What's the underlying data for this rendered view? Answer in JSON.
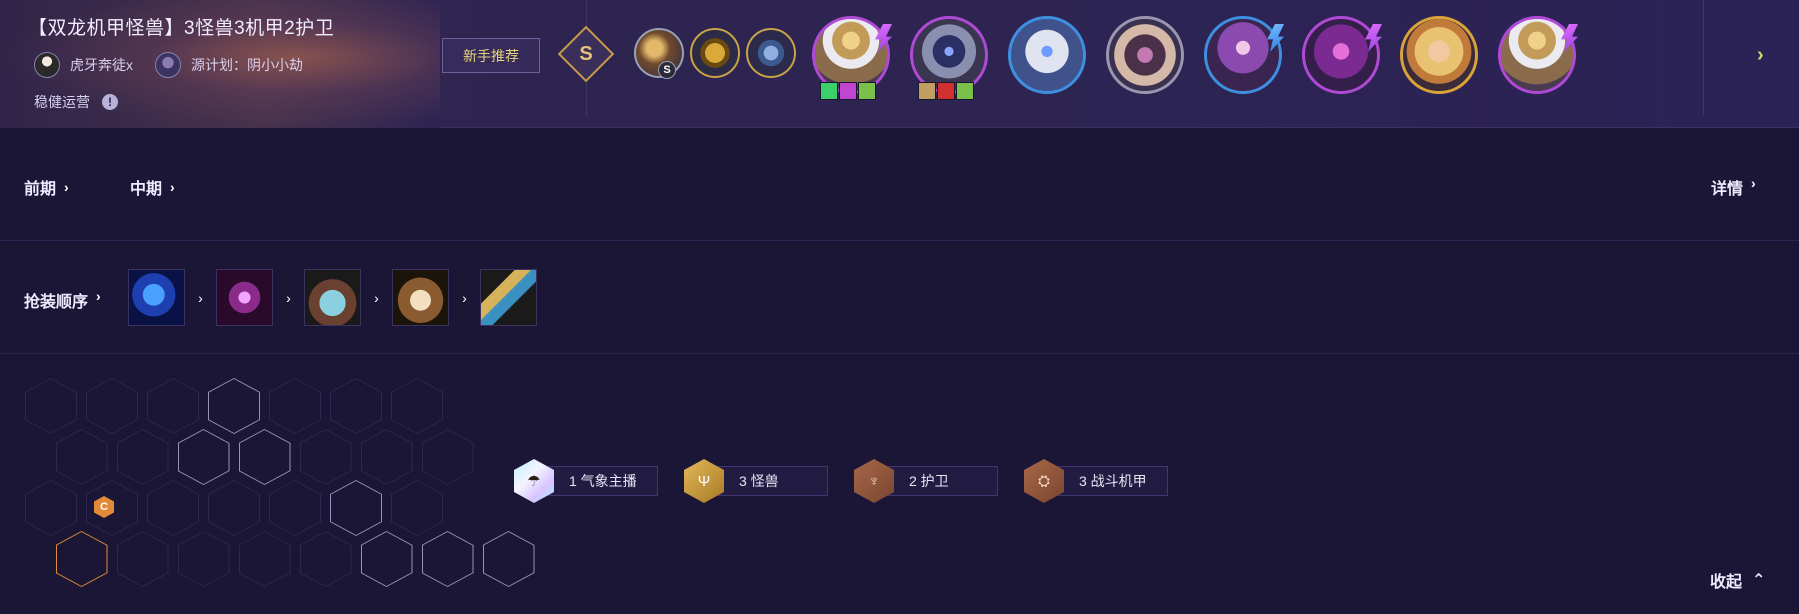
{
  "header": {
    "title": "【双龙机甲怪兽】3怪兽3机甲2护卫",
    "authors": [
      "虎牙奔徒x",
      "源计划：阴小小劫"
    ],
    "strategy": "稳健运营",
    "info_icon": "!",
    "newbie_tag": "新手推荐",
    "tier": "S",
    "augments": [
      {
        "name": "augment-icon",
        "badge": "S"
      },
      {
        "name": "emblem-icon"
      },
      {
        "name": "heart-icon"
      }
    ],
    "champions": [
      "champion-1",
      "champion-2",
      "champion-3",
      "champion-4",
      "champion-5",
      "champion-6",
      "champion-7",
      "champion-8"
    ],
    "next_arrow": "›"
  },
  "stages": {
    "early": "前期",
    "mid": "中期",
    "detail": "详情",
    "chevron": "›"
  },
  "items": {
    "label": "抢装顺序",
    "chevron": "›",
    "list": [
      "blue-buff-item",
      "spirit-visage-item",
      "bramble-vest-item",
      "gauntlet-item",
      "spatula-item"
    ]
  },
  "board": {
    "carry_badge": "C"
  },
  "traits": [
    {
      "count": "1",
      "name": "气象主播",
      "tier": "rainbow",
      "glyph": "☂"
    },
    {
      "count": "3",
      "name": "怪兽",
      "tier": "gold",
      "glyph": "Ψ"
    },
    {
      "count": "2",
      "name": "护卫",
      "tier": "bronze",
      "glyph": "♆"
    },
    {
      "count": "3",
      "name": "战斗机甲",
      "tier": "bronze",
      "glyph": "⛭"
    }
  ],
  "trait_labels": [
    "1 气象主播",
    "3 怪兽",
    "2 护卫",
    "3 战斗机甲"
  ],
  "footer": {
    "collapse": "收起",
    "collapse_arrow": "⌃"
  }
}
